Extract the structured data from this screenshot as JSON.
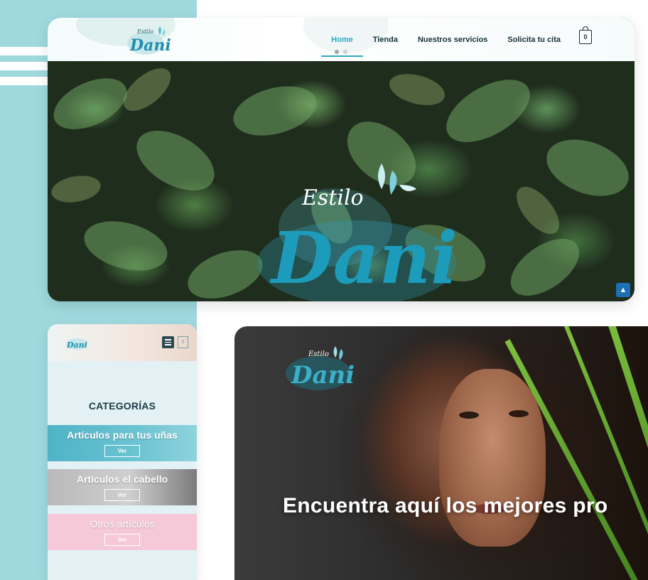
{
  "desktop": {
    "nav": [
      "Home",
      "Tienda",
      "Nuestros servicios",
      "Solicita tu cita"
    ],
    "cart_count": "0",
    "logo_script": "Estilo",
    "logo_name": "Dani"
  },
  "mobile": {
    "cart_count": "0",
    "categories_title": "CATEGORÍAS",
    "categories": [
      {
        "label": "Artículos para tus uñas",
        "button": "Ver"
      },
      {
        "label": "Artículos el cabello",
        "button": "Ver"
      },
      {
        "label": "Otros artículos",
        "button": "Ver"
      }
    ]
  },
  "hero": {
    "headline": "Encuentra aquí los mejores pro"
  },
  "colors": {
    "accent": "#2ba9c4",
    "panel": "#9fd9de",
    "nav_text": "#15313a"
  }
}
